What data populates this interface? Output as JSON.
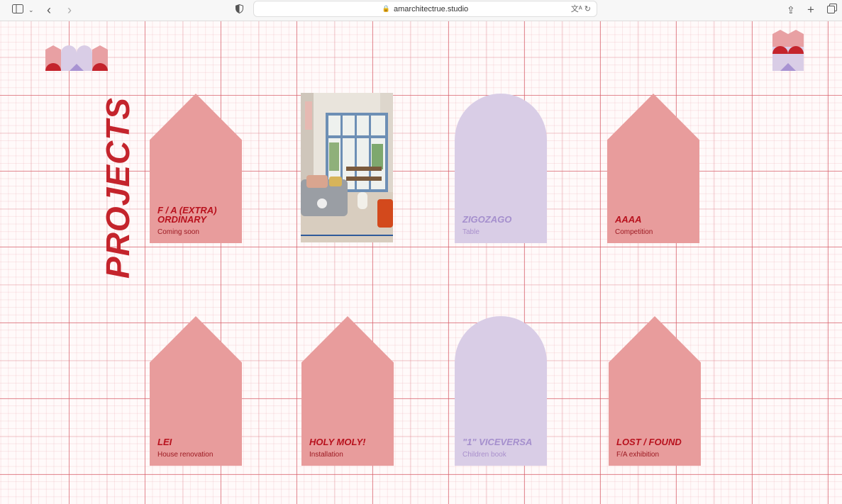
{
  "browser": {
    "url": "amarchitectrue.studio",
    "icons": [
      "sidebar-icon",
      "chevron-down-icon",
      "back-icon",
      "forward-icon",
      "shield-icon",
      "lock-icon",
      "translate-icon",
      "reload-icon",
      "share-icon",
      "new-tab-icon",
      "tabs-icon"
    ]
  },
  "page": {
    "heading": "PROJECTS",
    "colors": {
      "house": "#e89c9c",
      "arch": "#d9cde6",
      "title_red": "#c4242c",
      "grid": "#d65a64"
    }
  },
  "projects": [
    {
      "title": "F / A (EXTRA) ORDINARY",
      "subtitle": "Coming soon",
      "shape": "house"
    },
    {
      "title": "",
      "subtitle": "",
      "shape": "photo"
    },
    {
      "title": "ZIGOZAGO",
      "subtitle": "Table",
      "shape": "arch"
    },
    {
      "title": "AAAA",
      "subtitle": "Competition",
      "shape": "house"
    },
    {
      "title": "LEI",
      "subtitle": "House renovation",
      "shape": "house"
    },
    {
      "title": "HOLY MOLY!",
      "subtitle": "Installation",
      "shape": "house"
    },
    {
      "title": "\"1\" VICEVERSA",
      "subtitle": "Children book",
      "shape": "arch"
    },
    {
      "title": "LOST / FOUND",
      "subtitle": "F/A exhibition",
      "shape": "house"
    }
  ]
}
